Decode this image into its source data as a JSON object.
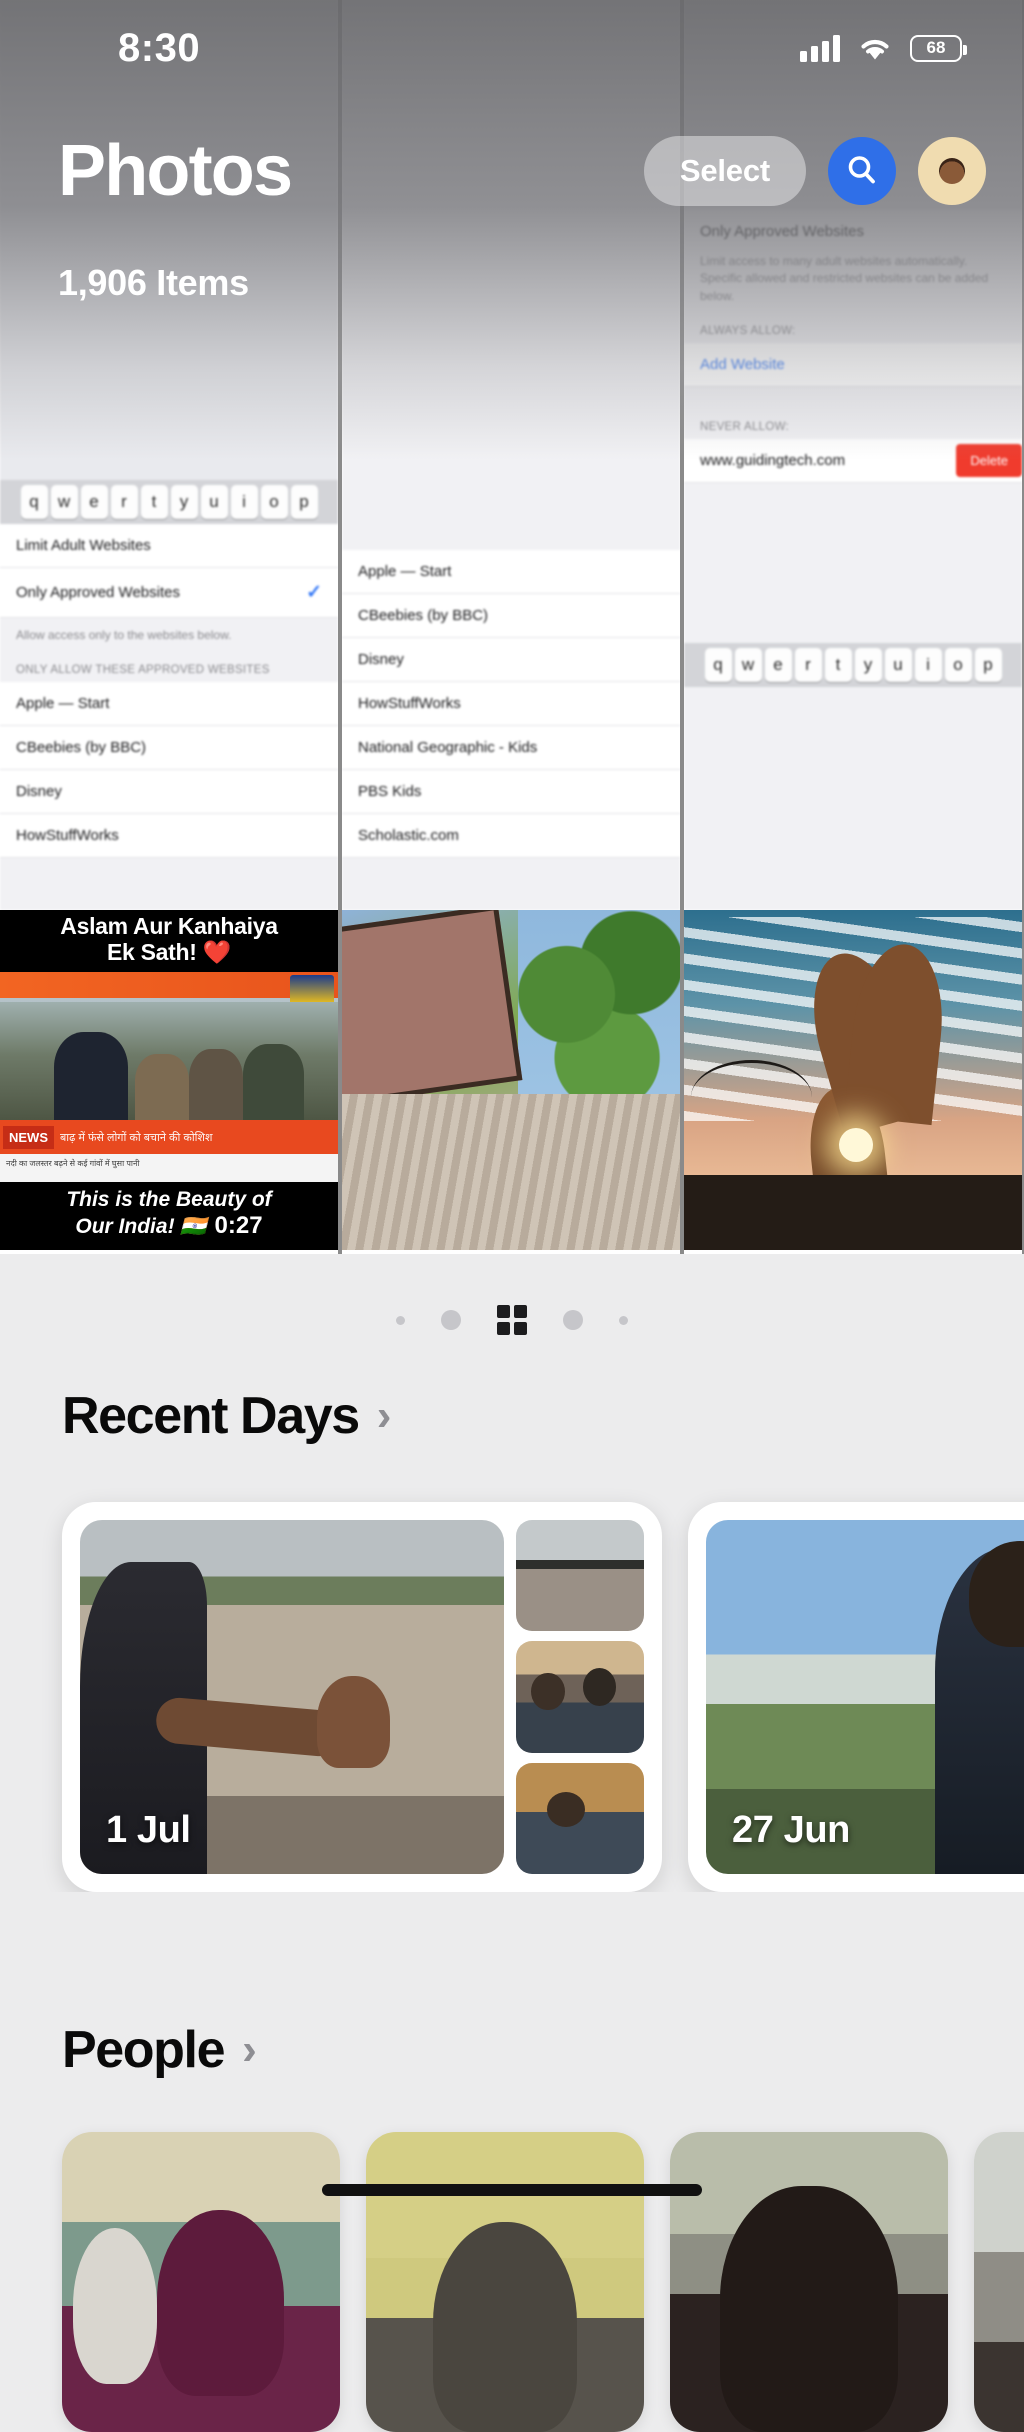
{
  "status_bar": {
    "time": "8:30",
    "signal_icon": "cellular-signal-icon",
    "wifi_icon": "wifi-icon",
    "battery_level": "68",
    "battery_icon": "battery-icon"
  },
  "header": {
    "title": "Photos",
    "items_count": "1,906 Items",
    "select_label": "Select",
    "search_icon": "search-icon",
    "avatar_icon": "avatar-icon"
  },
  "photo_grid": {
    "columns": [
      {
        "type": "screenshot",
        "keyboard_row": [
          "q",
          "w",
          "e",
          "r",
          "t",
          "y",
          "u",
          "i",
          "o",
          "p"
        ],
        "rows": [
          {
            "label": "Limit Adult Websites",
            "checked": false
          },
          {
            "label": "Only Approved Websites",
            "checked": true
          }
        ],
        "footnote": "Allow access only to the websites below.",
        "group_header": "ONLY ALLOW THESE APPROVED WEBSITES",
        "sites": [
          "Apple — Start",
          "CBeebies (by BBC)",
          "Disney",
          "HowStuffWorks"
        ],
        "photo": {
          "name": "news-video-thumbnail",
          "top_caption": "Aslam Aur Kanhaiya",
          "top_caption_2": "Ek Sath! ❤️",
          "ticker_label": "NEWS",
          "ticker_text": "बाढ़ में फंसे लोगों को बचाने की कोशिश",
          "ticker_sub": "नदी का जलस्तर बढ़ने से कई गांवों में घुसा पानी",
          "bottom_caption": "This is the Beauty of",
          "bottom_caption_2": "Our India! 🇮🇳",
          "duration": "0:27"
        }
      },
      {
        "type": "screenshot",
        "sites": [
          "Apple — Start",
          "CBeebies (by BBC)",
          "Disney",
          "HowStuffWorks",
          "National Geographic - Kids",
          "PBS Kids",
          "Scholastic.com"
        ],
        "photo": {
          "name": "roof-photo-thumbnail"
        }
      },
      {
        "type": "screenshot",
        "section_title": "Only Approved Websites",
        "description": "Limit access to many adult websites automatically. Specific allowed and restricted websites can be added below.",
        "always_allow_header": "ALWAYS ALLOW:",
        "add_website_label": "Add Website",
        "never_allow_header": "NEVER ALLOW:",
        "blocked_site": "www.guidingtech.com",
        "delete_label": "Delete",
        "keyboard_row": [
          "q",
          "w",
          "e",
          "r",
          "t",
          "y",
          "u",
          "i",
          "o",
          "p"
        ],
        "photo": {
          "name": "sunset-hand-photo-thumbnail"
        }
      }
    ]
  },
  "pager": {
    "dots": [
      "tiny",
      "small",
      "active-grid",
      "small",
      "tiny"
    ],
    "active_index": 2,
    "active_icon": "grid-view-icon"
  },
  "recent_days": {
    "title": "Recent Days",
    "chevron": "›",
    "cards": [
      {
        "date": "1 Jul",
        "name": "memory-card-1-jul"
      },
      {
        "date": "27 Jun",
        "name": "memory-card-27-jun"
      }
    ]
  },
  "people": {
    "title": "People",
    "chevron": "›",
    "cards": [
      {
        "name": "person-card-1"
      },
      {
        "name": "person-card-2"
      },
      {
        "name": "person-card-3"
      },
      {
        "name": "person-card-4"
      }
    ]
  },
  "colors": {
    "accent_blue": "#2f6fe8",
    "link_blue": "#3478f6",
    "delete_red": "#f03b2d",
    "background": "#ececed",
    "header_overlay": "#69696c"
  }
}
